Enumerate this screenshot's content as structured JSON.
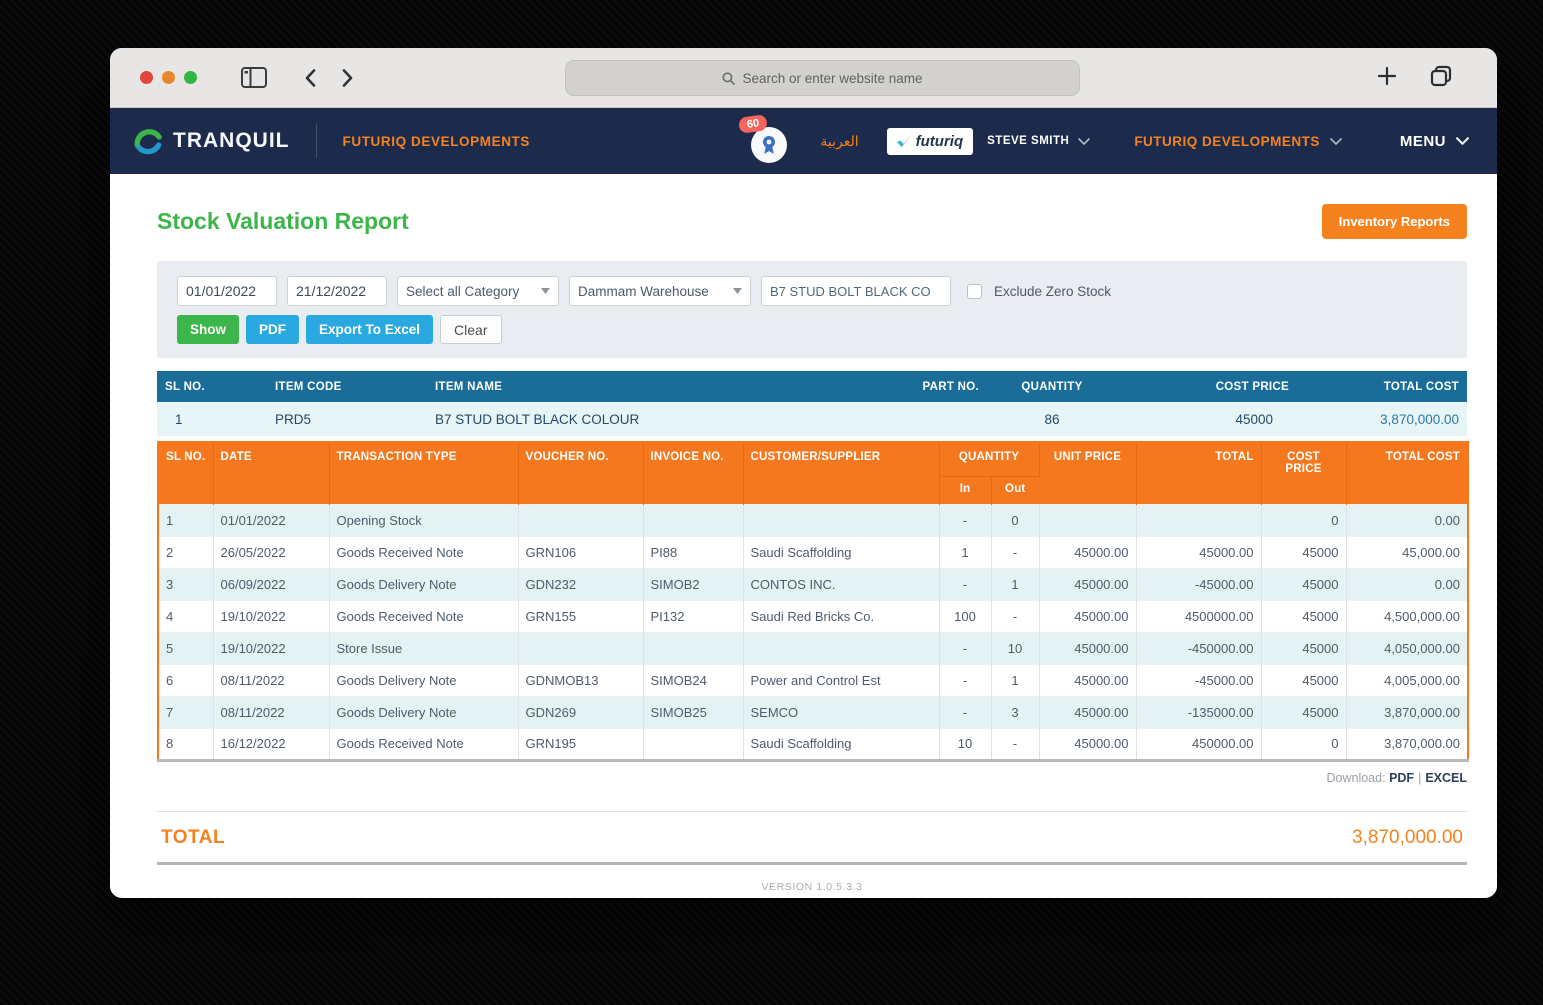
{
  "browser": {
    "search_placeholder": "Search or enter website name"
  },
  "navbar": {
    "brand": "TRANQUIL",
    "company": "FUTURIQ DEVELOPMENTS",
    "notification_count": "60",
    "language": "العربية",
    "org_logo_text": "futuriq",
    "user": "STEVE SMITH",
    "account": "FUTURIQ DEVELOPMENTS",
    "menu": "MENU"
  },
  "page": {
    "title": "Stock Valuation Report",
    "inventory_reports_button": "Inventory Reports"
  },
  "filters": {
    "date_from": "01/01/2022",
    "date_to": "21/12/2022",
    "category": "Select all Category",
    "warehouse": "Dammam Warehouse",
    "item": "B7 STUD BOLT BLACK CO",
    "exclude_zero_stock_label": "Exclude Zero Stock",
    "buttons": {
      "show": "Show",
      "pdf": "PDF",
      "export_excel": "Export To Excel",
      "clear": "Clear"
    }
  },
  "summary_table": {
    "headers": [
      "SL NO.",
      "ITEM CODE",
      "ITEM NAME",
      "PART NO.",
      "QUANTITY",
      "COST PRICE",
      "TOTAL COST"
    ],
    "row": {
      "sl": "1",
      "item_code": "PRD5",
      "item_name": "B7 STUD BOLT BLACK COLOUR",
      "part_no": "",
      "quantity": "86",
      "cost_price": "45000",
      "total_cost": "3,870,000.00"
    }
  },
  "detail_table": {
    "col_headers": {
      "sl": "SL NO.",
      "date": "DATE",
      "transaction_type": "TRANSACTION TYPE",
      "voucher_no": "VOUCHER NO.",
      "invoice_no": "INVOICE NO.",
      "customer_supplier": "CUSTOMER/SUPPLIER",
      "quantity": "QUANTITY",
      "in": "In",
      "out": "Out",
      "unit_price": "UNIT PRICE",
      "total": "TOTAL",
      "cost_price": "COST PRICE",
      "total_cost": "TOTAL COST"
    },
    "rows": [
      [
        "1",
        "01/01/2022",
        "Opening Stock",
        "",
        "",
        "",
        "-",
        "0",
        "",
        "",
        "0",
        "0.00"
      ],
      [
        "2",
        "26/05/2022",
        "Goods Received Note",
        "GRN106",
        "PI88",
        "Saudi Scaffolding",
        "1",
        "-",
        "45000.00",
        "45000.00",
        "45000",
        "45,000.00"
      ],
      [
        "3",
        "06/09/2022",
        "Goods Delivery Note",
        "GDN232",
        "SIMOB2",
        "CONTOS INC.",
        "-",
        "1",
        "45000.00",
        "-45000.00",
        "45000",
        "0.00"
      ],
      [
        "4",
        "19/10/2022",
        "Goods Received Note",
        "GRN155",
        "PI132",
        "Saudi Red Bricks Co.",
        "100",
        "-",
        "45000.00",
        "4500000.00",
        "45000",
        "4,500,000.00"
      ],
      [
        "5",
        "19/10/2022",
        "Store Issue",
        "",
        "",
        "",
        "-",
        "10",
        "45000.00",
        "-450000.00",
        "45000",
        "4,050,000.00"
      ],
      [
        "6",
        "08/11/2022",
        "Goods Delivery Note",
        "GDNMOB13",
        "SIMOB24",
        "Power and Control Est",
        "-",
        "1",
        "45000.00",
        "-45000.00",
        "45000",
        "4,005,000.00"
      ],
      [
        "7",
        "08/11/2022",
        "Goods Delivery Note",
        "GDN269",
        "SIMOB25",
        "SEMCO",
        "-",
        "3",
        "45000.00",
        "-135000.00",
        "45000",
        "3,870,000.00"
      ],
      [
        "8",
        "16/12/2022",
        "Goods Received Note",
        "GRN195",
        "",
        "Saudi Scaffolding",
        "10",
        "-",
        "45000.00",
        "450000.00",
        "0",
        "3,870,000.00"
      ]
    ]
  },
  "footer": {
    "download_label": "Download:",
    "download_pdf": "PDF",
    "download_separator": "|",
    "download_excel": "EXCEL",
    "total_label": "TOTAL",
    "total_value": "3,870,000.00",
    "version": "VERSION 1.0.5.3.3"
  },
  "colors": {
    "navbar_navy": "#1c2a4b",
    "accent_orange": "#f5821f",
    "header_steel_blue": "#1a6d98",
    "title_green": "#3cb54a",
    "button_blue": "#2aa9e1",
    "stripe_cyan": "#e4f2f3",
    "panel_gray": "#e9edf1"
  }
}
